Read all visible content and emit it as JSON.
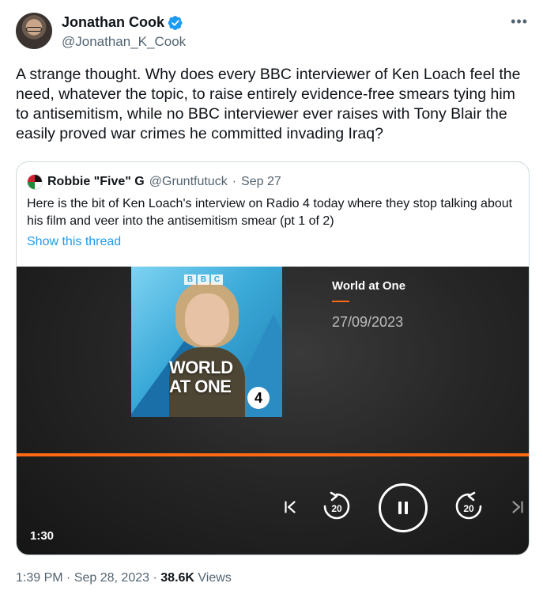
{
  "author": {
    "name": "Jonathan Cook",
    "handle": "@Jonathan_K_Cook",
    "verified_color": "#1d9bf0"
  },
  "more_icon": "more-horizontal-icon",
  "tweet_text": "A strange thought. Why does every BBC interviewer of Ken Loach feel the need, whatever the topic, to raise entirely evidence-free smears tying him to antisemitism, while no BBC interviewer ever raises with Tony Blair the easily proved war crimes he committed invading Iraq?",
  "quote": {
    "name": "Robbie \"Five\" G",
    "handle": "@Gruntfutuck",
    "separator": "·",
    "date": "Sep 27",
    "text": "Here is the bit of Ken Loach's interview on Radio 4 today where they stop talking about his film and veer into the antisemitism smear (pt 1 of 2)",
    "show_thread": "Show this thread"
  },
  "media": {
    "artwork": {
      "logo_letters": [
        "B",
        "B",
        "C"
      ],
      "title_line1": "WORLD",
      "title_line2": "AT ONE",
      "badge": "4"
    },
    "title": "World at One",
    "date": "27/09/2023",
    "progress": 1.0,
    "accent_color": "#ff6a13",
    "rewind_seconds": "20",
    "forward_seconds": "20",
    "duration": "1:30"
  },
  "footer": {
    "time": "1:39 PM",
    "separator": "·",
    "date": "Sep 28, 2023",
    "views_count": "38.6K",
    "views_label": "Views"
  }
}
